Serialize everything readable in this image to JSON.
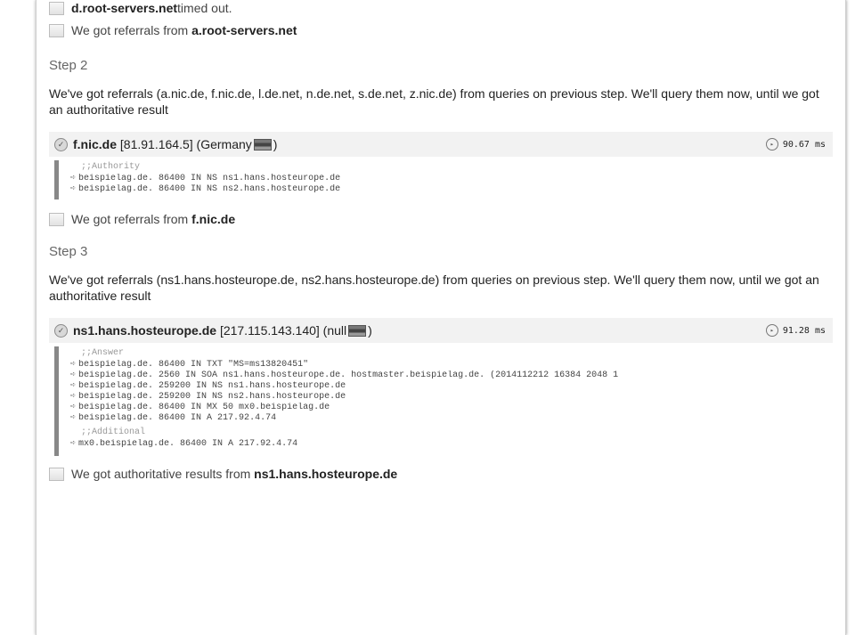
{
  "notes_top": [
    {
      "bold": "d.root-servers.net",
      "text": " timed out."
    },
    {
      "prefix": "We got referrals from ",
      "bold": "a.root-servers.net"
    }
  ],
  "step2": {
    "title": "Step 2",
    "text": "We've got referrals (a.nic.de, f.nic.de, l.de.net, n.de.net, s.de.net, z.nic.de) from queries on previous step. We'll query them now, until we got an authoritative result",
    "server": {
      "host": "f.nic.de",
      "ip": "[81.91.164.5]",
      "country_open": "(Germany",
      "country_close": ")",
      "time": "90.67 ms"
    },
    "authority_label": ";;Authority",
    "authority": [
      "beispielag.de. 86400 IN NS ns1.hans.hosteurope.de",
      "beispielag.de. 86400 IN NS ns2.hans.hosteurope.de"
    ],
    "note": {
      "prefix": "We got referrals from ",
      "bold": "f.nic.de"
    }
  },
  "step3": {
    "title": "Step 3",
    "text": "We've got referrals (ns1.hans.hosteurope.de, ns2.hans.hosteurope.de) from queries on previous step. We'll query them now, until we got an authoritative result",
    "server": {
      "host": "ns1.hans.hosteurope.de",
      "ip": "[217.115.143.140]",
      "country_open": "(null",
      "country_close": ")",
      "time": "91.28 ms"
    },
    "answer_label": ";;Answer",
    "answer": [
      "beispielag.de. 86400 IN TXT \"MS=ms13820451\"",
      "beispielag.de. 2560 IN SOA ns1.hans.hosteurope.de. hostmaster.beispielag.de. (2014112212 16384 2048 1",
      "beispielag.de. 259200 IN NS ns1.hans.hosteurope.de",
      "beispielag.de. 259200 IN NS ns2.hans.hosteurope.de",
      "beispielag.de. 86400 IN MX 50 mx0.beispielag.de",
      "beispielag.de. 86400 IN A 217.92.4.74"
    ],
    "additional_label": ";;Additional",
    "additional": [
      "mx0.beispielag.de. 86400 IN A 217.92.4.74"
    ],
    "note": {
      "prefix": "We got authoritative results from ",
      "bold": "ns1.hans.hosteurope.de"
    }
  }
}
